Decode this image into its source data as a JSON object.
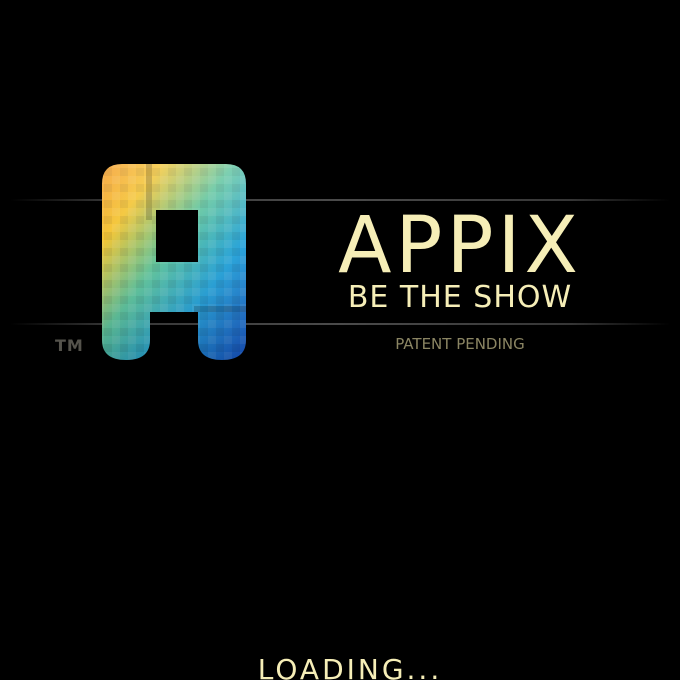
{
  "brand": {
    "name": "APPIX",
    "tagline": "BE THE SHOW",
    "trademark": "TM",
    "patent": "PATENT PENDING"
  },
  "status": {
    "loading": "LOADING..."
  },
  "logo": {
    "icon": "appix-a-logo-icon",
    "colors": {
      "orange": "#f58a12",
      "yellow": "#f3c22a",
      "teal": "#3db7a8",
      "blue": "#1f78d8",
      "deep_blue": "#1447c0"
    }
  },
  "colors": {
    "background": "#000000",
    "text": "#f6eeb7",
    "muted_text": "#8b8563",
    "trademark": "#55534c",
    "divider": "#4b4b4b"
  }
}
